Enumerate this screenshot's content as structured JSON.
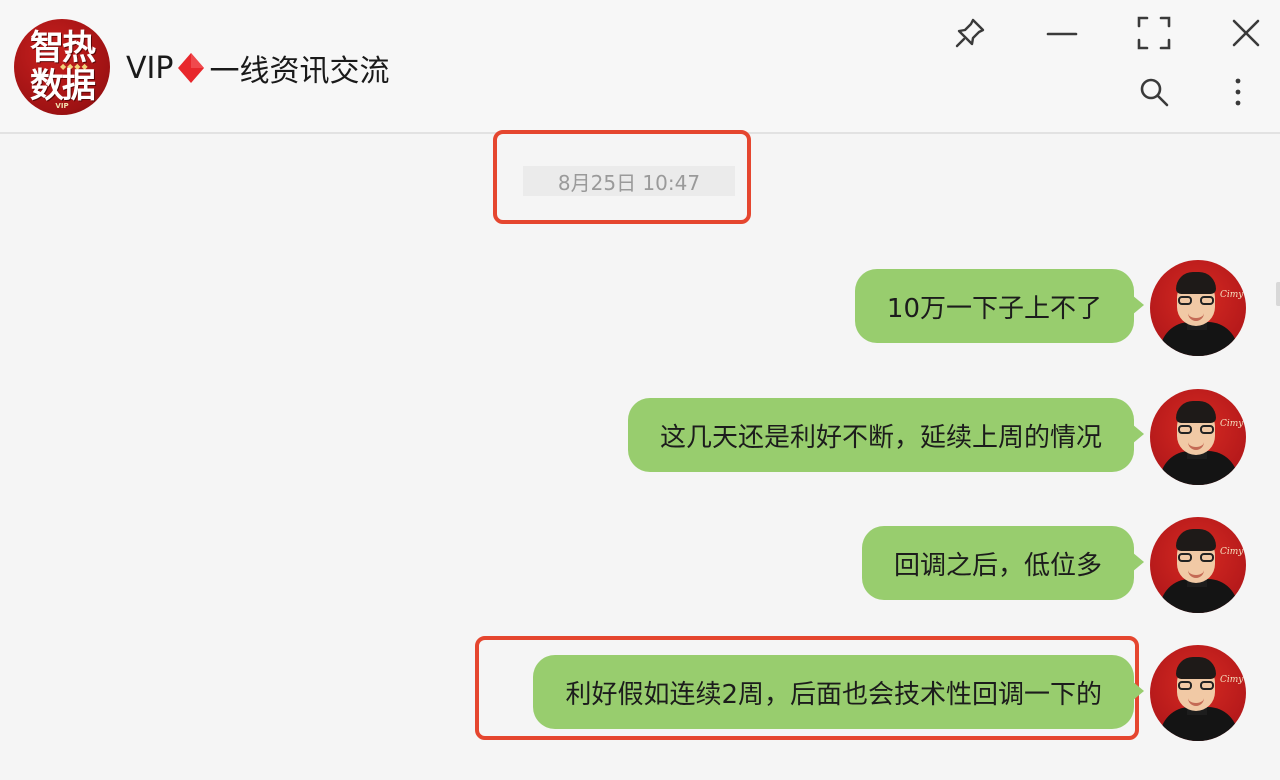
{
  "window": {
    "group_name_prefix": "VIP",
    "group_name_suffix": "一线资讯交流",
    "diamond_color": "#e8272c"
  },
  "group_avatar": {
    "line1": "智热",
    "line2": "数据",
    "badge": "VIP"
  },
  "header_icons": [
    "pin-icon",
    "minimize-icon",
    "fullscreen-icon",
    "close-icon",
    "search-icon",
    "more-icon"
  ],
  "timestamp": "8月25日 10:47",
  "messages": [
    {
      "text": "10万一下子上不了",
      "sender": "self"
    },
    {
      "text": "这几天还是利好不断，延续上周的情况",
      "sender": "self"
    },
    {
      "text": "回调之后，低位多",
      "sender": "self"
    },
    {
      "text": "利好假如连续2周，后面也会技术性回调一下的",
      "sender": "self"
    }
  ],
  "avatar_signature": "Cimy",
  "colors": {
    "bubble": "#98cd6e",
    "highlight": "#e5462f",
    "background": "#f5f5f5"
  }
}
